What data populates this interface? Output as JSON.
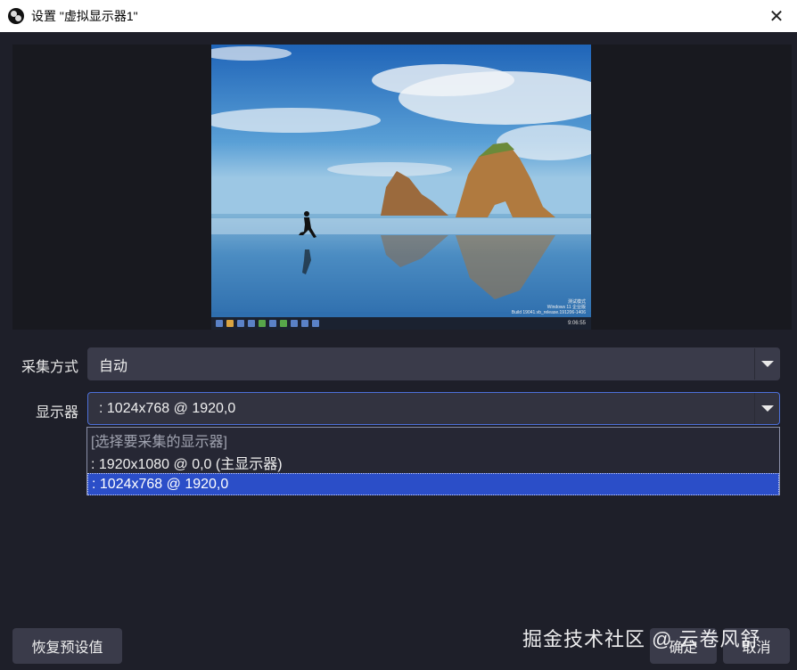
{
  "window": {
    "title": "设置 \"虚拟显示器1\"",
    "close_glyph": "✕"
  },
  "preview": {
    "taskbar_time": "9:06:55",
    "desktop_watermark_line1": "测试模式",
    "desktop_watermark_line2": "Windows 11 企业版",
    "desktop_watermark_line3": "Build 19041.vb_release.191206-1406"
  },
  "form": {
    "capture_method": {
      "label": "采集方式",
      "value": "自动"
    },
    "display": {
      "label": "显示器",
      "value": ": 1024x768 @ 1920,0",
      "options": [
        "[选择要采集的显示器]",
        ": 1920x1080 @ 0,0 (主显示器)",
        ": 1024x768 @ 1920,0"
      ],
      "selected_index": 2
    }
  },
  "buttons": {
    "restore_defaults": "恢复预设值",
    "ok": "确定",
    "cancel": "取消"
  },
  "overlay_watermark": "掘金技术社区 @ 云卷风舒",
  "colors": {
    "background": "#1e1f29",
    "accent": "#2b4ec8",
    "focus_border": "#4c6fd8"
  }
}
